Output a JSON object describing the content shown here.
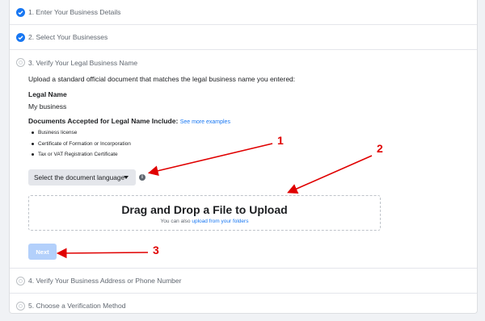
{
  "steps": [
    {
      "label": "1. Enter Your Business Details",
      "status": "done"
    },
    {
      "label": "2. Select Your Businesses",
      "status": "done"
    },
    {
      "label": "3. Verify Your Legal Business Name",
      "status": "current"
    },
    {
      "label": "4. Verify Your Business Address or Phone Number",
      "status": "pending"
    },
    {
      "label": "5. Choose a Verification Method",
      "status": "pending"
    }
  ],
  "verify": {
    "intro": "Upload a standard official document that matches the legal business name you entered:",
    "legal_name_label": "Legal Name",
    "legal_name_value": "My business",
    "docs_heading": "Documents Accepted for Legal Name Include:",
    "see_examples_link": "See more examples",
    "documents": [
      "Business license",
      "Certificate of Formation or Incorporation",
      "Tax or VAT Registration Certificate"
    ],
    "language_select": "Select the document language",
    "dropzone_title": "Drag and Drop a File to Upload",
    "dropzone_sub_prefix": "You can also",
    "dropzone_sub_link": "upload from your folders",
    "next_button": "Next"
  },
  "callouts": [
    "1",
    "2",
    "3"
  ],
  "colors": {
    "accent": "#1877f2",
    "annotation": "#e00000",
    "next_disabled": "#b3d0fb"
  },
  "icons": [
    "check-circle-icon",
    "radio-empty-icon",
    "info-icon",
    "caret-down-icon"
  ]
}
